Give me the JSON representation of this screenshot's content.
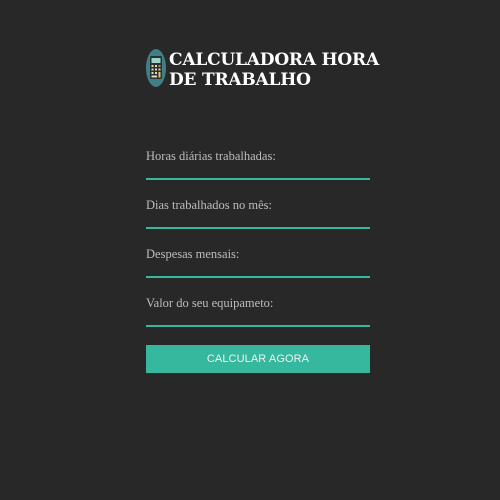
{
  "header": {
    "logo_icon": "calculator-icon",
    "title_line1": "CALCULADORA HORA",
    "title_line2": "DE TRABALHO"
  },
  "form": {
    "fields": [
      {
        "label": "Horas diárias trabalhadas:",
        "value": "",
        "placeholder": ""
      },
      {
        "label": "Dias trabalhados no mês:",
        "value": "",
        "placeholder": ""
      },
      {
        "label": "Despesas mensais:",
        "value": "",
        "placeholder": ""
      },
      {
        "label": "Valor do seu equipameto:",
        "value": "",
        "placeholder": ""
      }
    ],
    "submit_label": "CALCULAR AGORA"
  },
  "colors": {
    "background": "#282828",
    "accent": "#35b89e",
    "label_text": "#bdbdbd",
    "title_text": "#ffffff"
  }
}
